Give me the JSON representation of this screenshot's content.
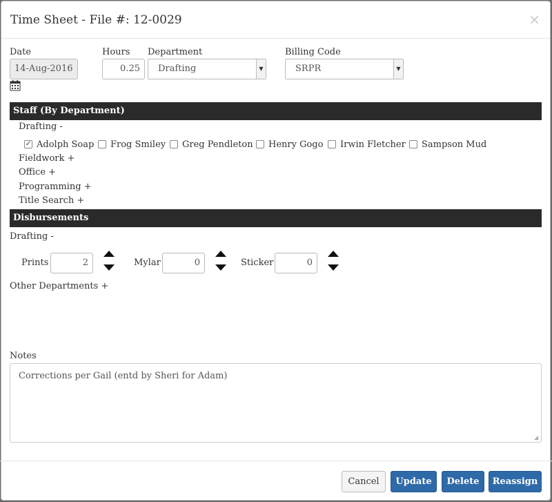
{
  "header": {
    "title": "Time Sheet - File #: 12-0029",
    "close": "×"
  },
  "form": {
    "date_label": "Date",
    "date_value": "14-Aug-2016",
    "hours_label": "Hours",
    "hours_value": "0.25",
    "department_label": "Department",
    "department_value": "Drafting",
    "billing_label": "Billing Code",
    "billing_value": "SRPR"
  },
  "staff": {
    "heading": "Staff (By Department)",
    "current_group": "Drafting -",
    "members": [
      {
        "name": "Adolph Soap",
        "checked": true
      },
      {
        "name": "Frog Smiley",
        "checked": false
      },
      {
        "name": "Greg Pendleton",
        "checked": false
      },
      {
        "name": "Henry Gogo",
        "checked": false
      },
      {
        "name": "Irwin Fletcher",
        "checked": false
      },
      {
        "name": "Sampson Mud",
        "checked": false
      }
    ],
    "other_groups": [
      "Fieldwork +",
      "Office +",
      "Programming +",
      "Title Search +"
    ]
  },
  "disbursements": {
    "heading": "Disbursements",
    "current_group": "Drafting -",
    "items": [
      {
        "label": "Prints",
        "value": "2"
      },
      {
        "label": "Mylar",
        "value": "0"
      },
      {
        "label": "Sticker",
        "value": "0"
      }
    ],
    "other": "Other Departments +"
  },
  "notes": {
    "label": "Notes",
    "value": "Corrections per Gail (entd by Sheri for Adam)"
  },
  "footer": {
    "cancel": "Cancel",
    "update": "Update",
    "delete": "Delete",
    "reassign": "Reassign"
  },
  "colors": {
    "primary": "#2f6aa8",
    "section_bar": "#2a2a2a"
  }
}
